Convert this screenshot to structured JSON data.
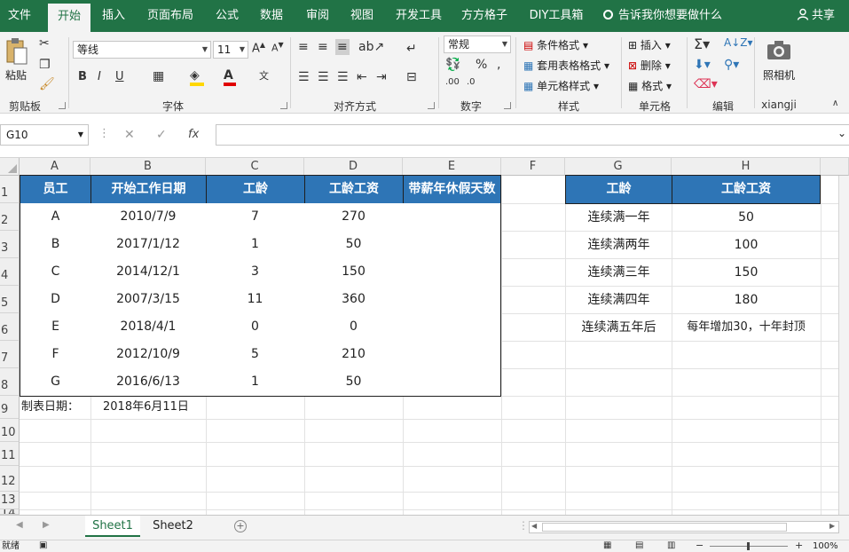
{
  "menu": {
    "tabs": [
      {
        "label": "文件"
      },
      {
        "label": "开始"
      },
      {
        "label": "插入"
      },
      {
        "label": "页面布局"
      },
      {
        "label": "公式"
      },
      {
        "label": "数据"
      },
      {
        "label": "审阅"
      },
      {
        "label": "视图"
      },
      {
        "label": "开发工具"
      },
      {
        "label": "方方格子"
      },
      {
        "label": "DIY工具箱"
      }
    ],
    "tell_me": "告诉我你想要做什么",
    "share": "共享"
  },
  "ribbon": {
    "clipboard": {
      "paste": "粘贴",
      "label": "剪贴板"
    },
    "font": {
      "name": "等线",
      "size": "11",
      "label": "字体"
    },
    "alignment": {
      "label": "对齐方式"
    },
    "number": {
      "format": "常规",
      "label": "数字"
    },
    "styles": {
      "conditional": "条件格式",
      "table": "套用表格格式",
      "cell": "单元格样式",
      "label": "样式"
    },
    "cells": {
      "insert": "插入",
      "delete": "删除",
      "format": "格式",
      "label": "单元格"
    },
    "editing": {
      "label": "编辑"
    },
    "camera": {
      "label": "照相机",
      "group": "xiangji"
    }
  },
  "formula_bar": {
    "name_box": "G10",
    "fx": "fx",
    "value": ""
  },
  "columns": [
    "A",
    "B",
    "C",
    "D",
    "E",
    "F",
    "G",
    "H"
  ],
  "rows": [
    "1",
    "2",
    "3",
    "4",
    "5",
    "6",
    "7",
    "8",
    "9",
    "10",
    "11",
    "12",
    "13",
    "14"
  ],
  "main_table": {
    "headers": [
      "员工",
      "开始工作日期",
      "工龄",
      "工龄工资",
      "带薪年休假天数"
    ],
    "rows": [
      [
        "A",
        "2010/7/9",
        "7",
        "270",
        ""
      ],
      [
        "B",
        "2017/1/12",
        "1",
        "50",
        ""
      ],
      [
        "C",
        "2014/12/1",
        "3",
        "150",
        ""
      ],
      [
        "D",
        "2007/3/15",
        "11",
        "360",
        ""
      ],
      [
        "E",
        "2018/4/1",
        "0",
        "0",
        ""
      ],
      [
        "F",
        "2012/10/9",
        "5",
        "210",
        ""
      ],
      [
        "G",
        "2016/6/13",
        "1",
        "50",
        ""
      ]
    ]
  },
  "report_date": {
    "label": "制表日期：",
    "value": "2018年6月11日"
  },
  "ref_table": {
    "headers": [
      "工龄",
      "工龄工资"
    ],
    "rows": [
      [
        "连续满一年",
        "50"
      ],
      [
        "连续满两年",
        "100"
      ],
      [
        "连续满三年",
        "150"
      ],
      [
        "连续满四年",
        "180"
      ],
      [
        "连续满五年后",
        "每年增加30，十年封顶"
      ]
    ]
  },
  "sheets": [
    {
      "label": "Sheet1"
    },
    {
      "label": "Sheet2"
    }
  ],
  "status": {
    "ready": "就绪",
    "zoom": "100%"
  },
  "colors": {
    "excel_green": "#217346",
    "header_blue": "#2e75b6"
  }
}
